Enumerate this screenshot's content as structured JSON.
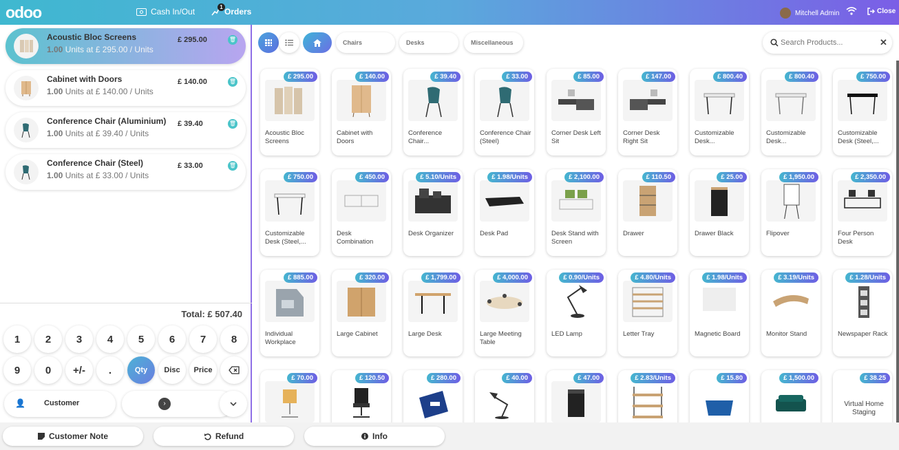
{
  "topbar": {
    "logo": "odoo",
    "cash_label": "Cash In/Out",
    "orders_label": "Orders",
    "orders_badge": "1",
    "user_name": "Mitchell Admin",
    "close_label": "Close"
  },
  "order": {
    "lines": [
      {
        "name": "Acoustic Bloc Screens",
        "qty": "1.00",
        "qty_text": "Units at £ 295.00 / Units",
        "price": "£ 295.00"
      },
      {
        "name": "Cabinet with Doors",
        "qty": "1.00",
        "qty_text": "Units at £ 140.00 / Units",
        "price": "£ 140.00"
      },
      {
        "name": "Conference Chair (Aluminium)",
        "qty": "1.00",
        "qty_text": "Units at £ 39.40 / Units",
        "price": "£ 39.40"
      },
      {
        "name": "Conference Chair (Steel)",
        "qty": "1.00",
        "qty_text": "Units at £ 33.00 / Units",
        "price": "£ 33.00"
      }
    ],
    "total": "Total: £ 507.40"
  },
  "numpad": {
    "row1": [
      "1",
      "2",
      "3",
      "4",
      "5",
      "6",
      "7",
      "8"
    ],
    "row2": [
      "9",
      "0",
      "+/-",
      ".",
      "Qty",
      "Disc",
      "Price"
    ],
    "customer_label": "Customer"
  },
  "categories": [
    "Chairs",
    "Desks",
    "Miscellaneous"
  ],
  "search": {
    "placeholder": "Search Products..."
  },
  "products": [
    {
      "name": "Acoustic Bloc Screens",
      "price": "£ 295.00"
    },
    {
      "name": "Cabinet with Doors",
      "price": "£ 140.00"
    },
    {
      "name": "Conference Chair...",
      "price": "£ 39.40"
    },
    {
      "name": "Conference Chair (Steel)",
      "price": "£ 33.00"
    },
    {
      "name": "Corner Desk Left Sit",
      "price": "£ 85.00"
    },
    {
      "name": "Corner Desk Right Sit",
      "price": "£ 147.00"
    },
    {
      "name": "Customizable Desk...",
      "price": "£ 800.40"
    },
    {
      "name": "Customizable Desk...",
      "price": "£ 800.40"
    },
    {
      "name": "Customizable Desk (Steel,...",
      "price": "£ 750.00"
    },
    {
      "name": "Customizable Desk (Steel,...",
      "price": "£ 750.00"
    },
    {
      "name": "Desk Combination",
      "price": "£ 450.00"
    },
    {
      "name": "Desk Organizer",
      "price": "£ 5.10/Units"
    },
    {
      "name": "Desk Pad",
      "price": "£ 1.98/Units"
    },
    {
      "name": "Desk Stand with Screen",
      "price": "£ 2,100.00"
    },
    {
      "name": "Drawer",
      "price": "£ 110.50"
    },
    {
      "name": "Drawer Black",
      "price": "£ 25.00"
    },
    {
      "name": "Flipover",
      "price": "£ 1,950.00"
    },
    {
      "name": "Four Person Desk",
      "price": "£ 2,350.00"
    },
    {
      "name": "Individual Workplace",
      "price": "£ 885.00"
    },
    {
      "name": "Large Cabinet",
      "price": "£ 320.00"
    },
    {
      "name": "Large Desk",
      "price": "£ 1,799.00"
    },
    {
      "name": "Large Meeting Table",
      "price": "£ 4,000.00"
    },
    {
      "name": "LED Lamp",
      "price": "£ 0.90/Units"
    },
    {
      "name": "Letter Tray",
      "price": "£ 4.80/Units"
    },
    {
      "name": "Magnetic Board",
      "price": "£ 1.98/Units"
    },
    {
      "name": "Monitor Stand",
      "price": "£ 3.19/Units"
    },
    {
      "name": "Newspaper Rack",
      "price": "£ 1.28/Units"
    },
    {
      "name": "",
      "price": "£ 70.00"
    },
    {
      "name": "",
      "price": "£ 120.50"
    },
    {
      "name": "",
      "price": "£ 280.00"
    },
    {
      "name": "",
      "price": "£ 40.00"
    },
    {
      "name": "",
      "price": "£ 47.00"
    },
    {
      "name": "",
      "price": "£ 2.83/Units"
    },
    {
      "name": "",
      "price": "£ 15.80"
    },
    {
      "name": "",
      "price": "£ 1,500.00"
    },
    {
      "name": "Virtual Home Staging",
      "price": "£ 38.25"
    }
  ],
  "bottom": {
    "note_label": "Customer Note",
    "refund_label": "Refund",
    "info_label": "Info"
  },
  "colors": {
    "accent_teal": "#4ac4c9",
    "accent_purple": "#7b5ee6"
  }
}
